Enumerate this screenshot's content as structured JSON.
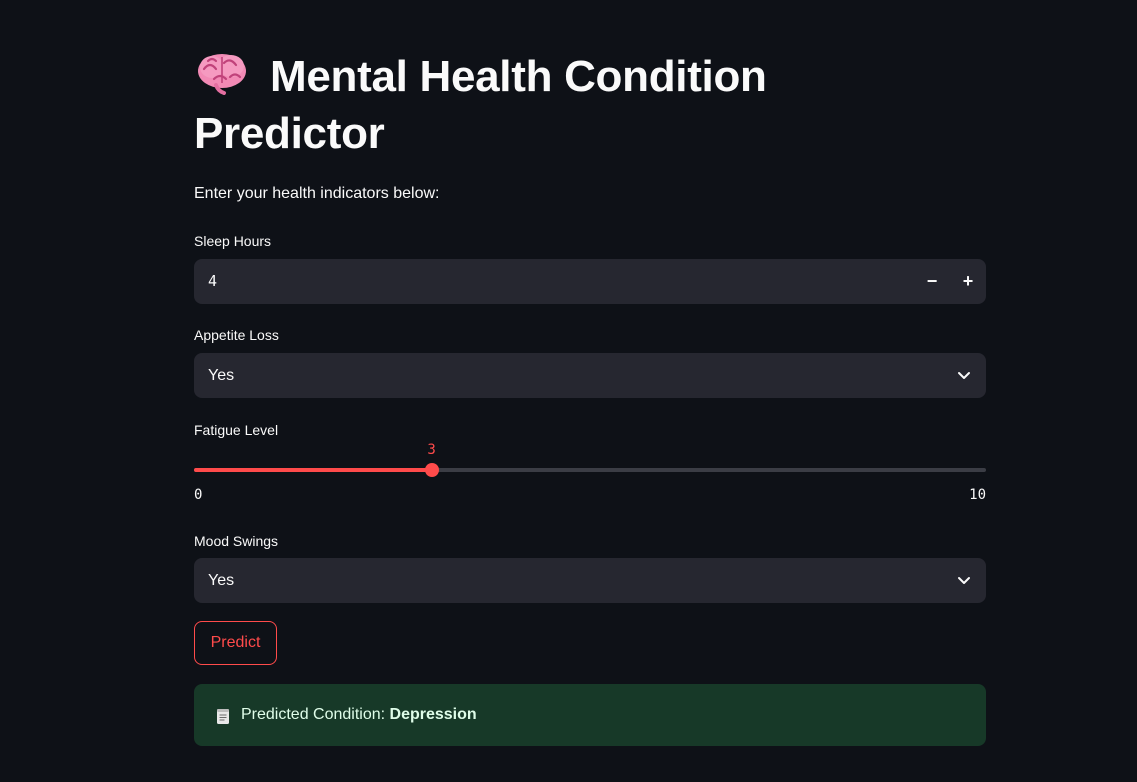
{
  "title": {
    "icon": "brain-icon",
    "line1": "Mental Health Condition",
    "line2": "Predictor"
  },
  "subtitle": "Enter your health indicators below:",
  "sleep_hours": {
    "label": "Sleep Hours",
    "value": "4",
    "decrement": "−",
    "increment": "+"
  },
  "appetite_loss": {
    "label": "Appetite Loss",
    "value": "Yes"
  },
  "fatigue_level": {
    "label": "Fatigue Level",
    "value": 3,
    "value_label": "3",
    "min": 0,
    "max": 10,
    "min_label": "0",
    "max_label": "10"
  },
  "mood_swings": {
    "label": "Mood Swings",
    "value": "Yes"
  },
  "predict_button": "Predict",
  "result": {
    "icon": "scroll-icon",
    "prefix": "Predicted Condition: ",
    "condition": "Depression"
  },
  "colors": {
    "background": "#0e1117",
    "input_bg": "#262730",
    "accent": "#ff4b4b",
    "success_bg": "#173928"
  }
}
